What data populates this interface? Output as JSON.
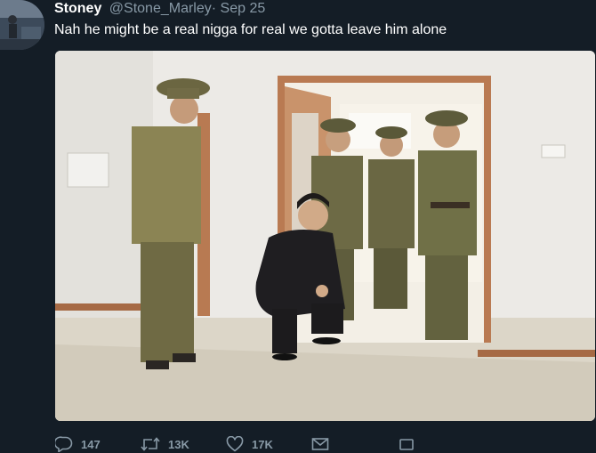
{
  "tweet": {
    "display_name": "Stoney",
    "handle": "@Stone_Marley",
    "separator": "·",
    "date": "Sep 25",
    "text": "Nah he might be a real nigga for real we gotta leave him alone"
  },
  "actions": {
    "reply_count": "147",
    "retweet_count": "13K",
    "like_count": "17K"
  },
  "colors": {
    "background": "#141d26",
    "text": "#ffffff",
    "secondary": "#8899a6"
  },
  "icons": [
    "reply-icon",
    "retweet-icon",
    "like-icon",
    "direct-message-icon",
    "bookmark-icon"
  ]
}
